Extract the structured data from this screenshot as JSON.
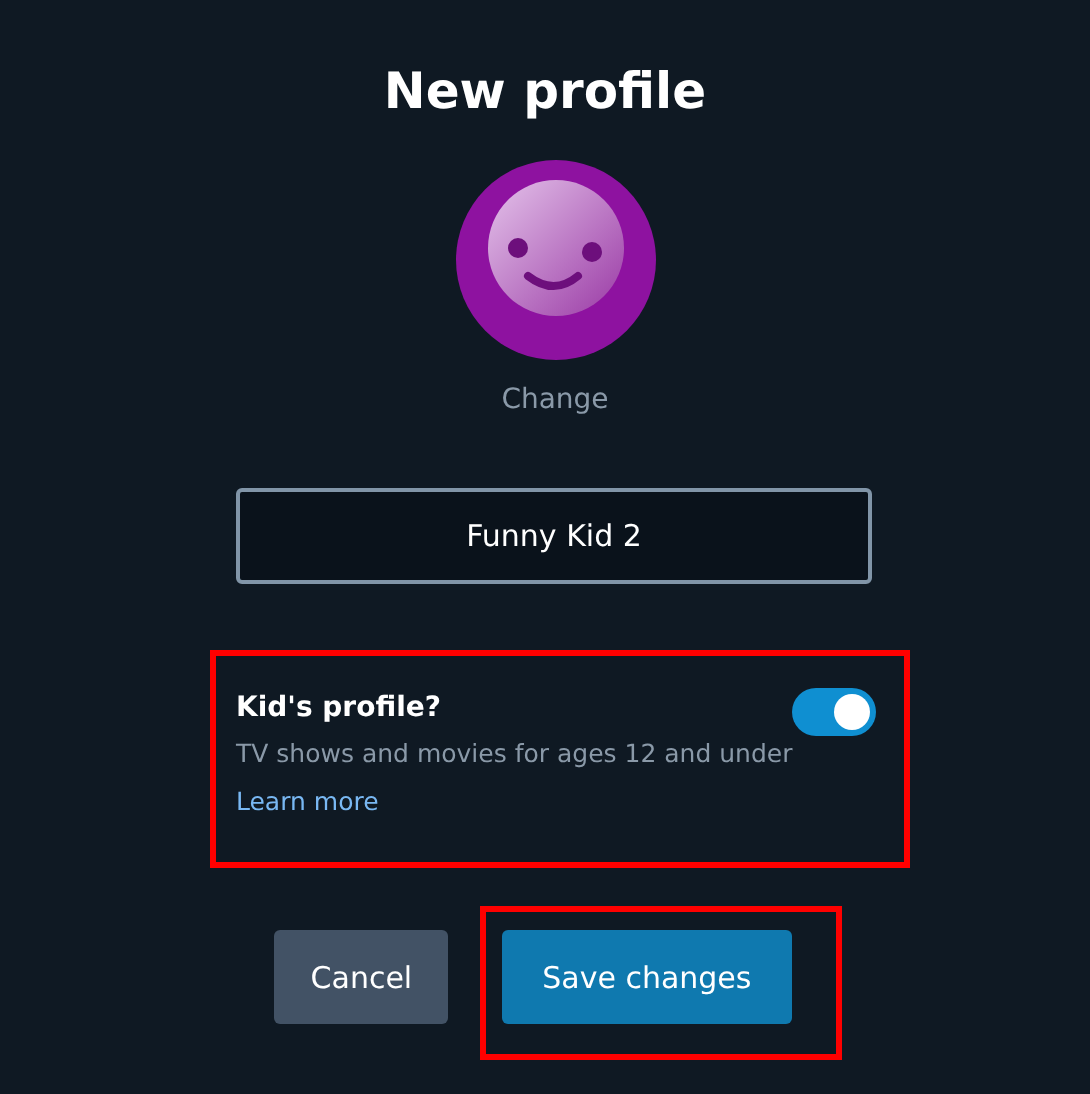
{
  "title": "New profile",
  "avatar": {
    "change_label": "Change"
  },
  "name_field": {
    "value": "Funny Kid 2"
  },
  "kids_profile": {
    "label": "Kid's profile?",
    "description": "TV shows and movies for ages 12 and under",
    "link": "Learn more",
    "on": true,
    "highlighted": true
  },
  "buttons": [
    {
      "label": "Cancel",
      "kind": "secondary",
      "highlighted": false
    },
    {
      "label": "Save changes",
      "kind": "primary",
      "highlighted": true
    }
  ]
}
